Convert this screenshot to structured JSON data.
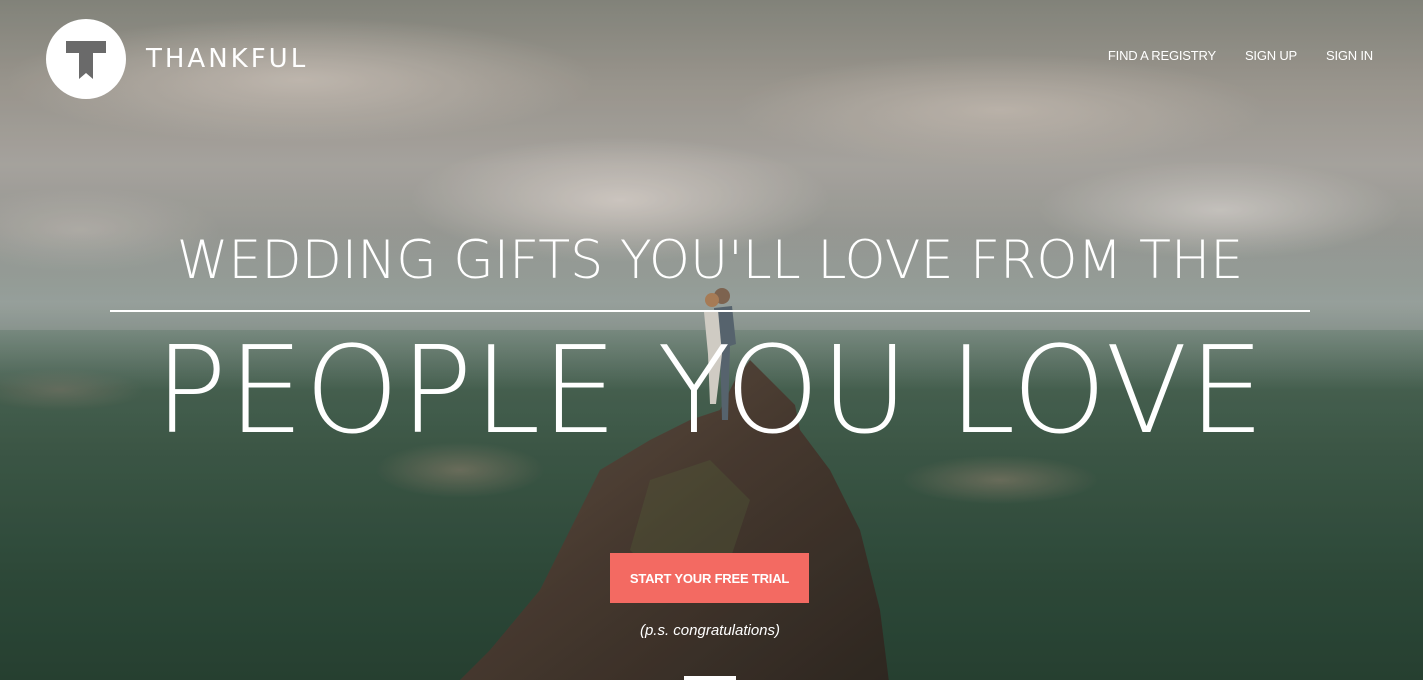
{
  "brand": {
    "logo_icon": "t-logo-icon",
    "name": "THANKFUL"
  },
  "nav": {
    "items": [
      {
        "label": "FIND A REGISTRY"
      },
      {
        "label": "SIGN UP"
      },
      {
        "label": "SIGN IN"
      }
    ]
  },
  "hero": {
    "headline_line1": "WEDDING GIFTS YOU'LL LOVE FROM THE",
    "headline_line2": "PEOPLE YOU LOVE",
    "cta_label": "START YOUR FREE TRIAL",
    "ps_text": "(p.s. congratulations)"
  },
  "colors": {
    "cta_background": "#f36a62",
    "text": "#ffffff"
  }
}
